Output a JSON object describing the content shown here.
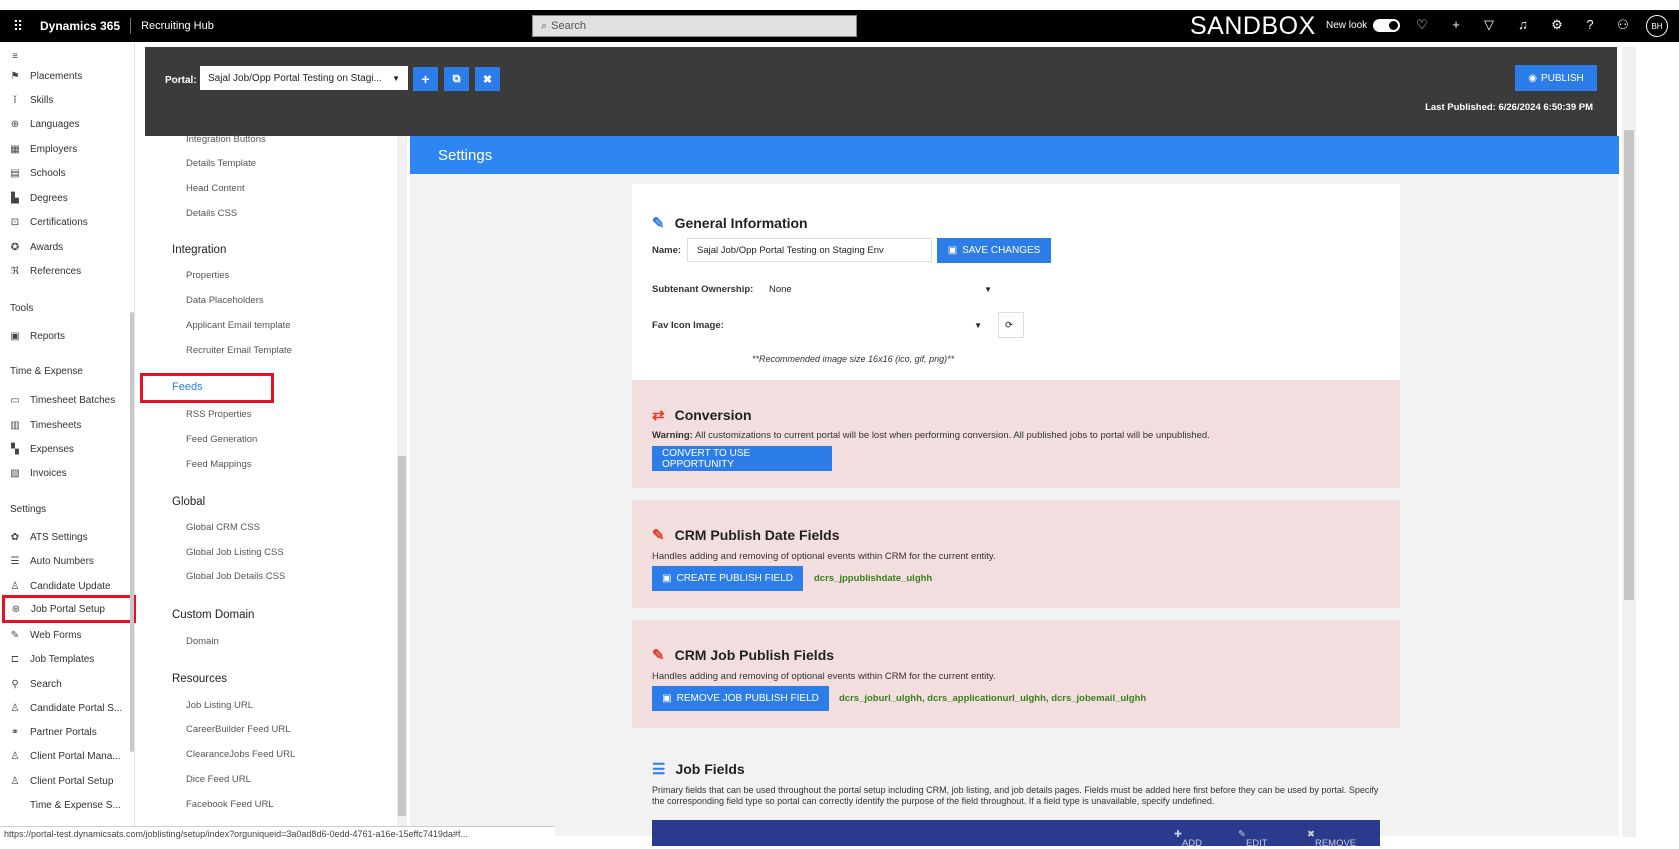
{
  "topbar": {
    "app_name": "Dynamics 365",
    "hub": "Recruiting Hub",
    "search_placeholder": "Search",
    "env_label": "SANDBOX",
    "new_look": "New look",
    "avatar": "BH"
  },
  "nav": {
    "items_top": [
      "Placements",
      "Skills",
      "Languages",
      "Employers",
      "Schools",
      "Degrees",
      "Certifications",
      "Awards",
      "References"
    ],
    "tools_head": "Tools",
    "reports": "Reports",
    "time_head": "Time & Expense",
    "time_items": [
      "Timesheet Batches",
      "Timesheets",
      "Expenses",
      "Invoices"
    ],
    "settings_head": "Settings",
    "settings_items": [
      "ATS Settings",
      "Auto Numbers",
      "Candidate Update",
      "Job Portal Setup",
      "Web Forms",
      "Job Templates",
      "Search",
      "Candidate Portal S...",
      "Partner Portals",
      "Client Portal Mana...",
      "Client Portal Setup",
      "Time & Expense S..."
    ]
  },
  "portal": {
    "label": "Portal:",
    "selected": "Sajal Job/Opp Portal Testing on Stagi...",
    "publish": "PUBLISH",
    "last_published": "Last Published: 6/26/2024 6:50:39 PM"
  },
  "panel": {
    "top_links": [
      "Integration Buttons",
      "Details Template",
      "Head Content",
      "Details CSS"
    ],
    "integration_head": "Integration",
    "integration_links": [
      "Properties",
      "Data Placeholders",
      "Applicant Email template",
      "Recruiter Email Template"
    ],
    "feeds_head": "Feeds",
    "feeds_links": [
      "RSS Properties",
      "Feed Generation",
      "Feed Mappings"
    ],
    "global_head": "Global",
    "global_links": [
      "Global CRM CSS",
      "Global Job Listing CSS",
      "Global Job Details CSS"
    ],
    "domain_head": "Custom Domain",
    "domain_links": [
      "Domain"
    ],
    "resources_head": "Resources",
    "resources_links": [
      "Job Listing URL",
      "CareerBuilder Feed URL",
      "ClearanceJobs Feed URL",
      "Dice Feed URL",
      "Facebook Feed URL"
    ]
  },
  "main": {
    "header": "Settings",
    "general": {
      "title": "General Information",
      "name_label": "Name:",
      "name_value": "Sajal Job/Opp Portal Testing on Staging Env",
      "save": "SAVE CHANGES",
      "subtenant_label": "Subtenant Ownership:",
      "subtenant_value": "None",
      "favicon_label": "Fav Icon Image:",
      "favicon_note": "**Recommended image size 16x16 (ico, gif, png)**"
    },
    "conversion": {
      "title": "Conversion",
      "warning_label": "Warning:",
      "warning_text": "All customizations to current portal will be lost when performing conversion. All published jobs to portal will be unpublished.",
      "button": "CONVERT TO USE OPPORTUNITY"
    },
    "publish_date": {
      "title": "CRM Publish Date Fields",
      "desc": "Handles adding and removing of optional events within CRM for the current entity.",
      "button": "CREATE PUBLISH FIELD",
      "field": "dcrs_jppublishdate_ulghh"
    },
    "job_publish": {
      "title": "CRM Job Publish Fields",
      "desc": "Handles adding and removing of optional events within CRM for the current entity.",
      "button": "REMOVE JOB PUBLISH FIELD",
      "fields": "dcrs_joburl_ulghh, dcrs_applicationurl_ulghh, dcrs_jobemail_ulghh"
    },
    "job_fields": {
      "title": "Job Fields",
      "desc": "Primary fields that can be used throughout the portal setup including CRM, job listing, and job details pages. Fields must be added here first before they can be used by portal. Specify the corresponding field type so portal can correctly identify the purpose of the field throughout. If a field type is unavailable, specify undefined.",
      "add": "ADD",
      "edit": "EDIT",
      "remove": "REMOVE"
    }
  },
  "status_url": "https://portal-test.dynamicsats.com/joblisting/setup/index?orguniqueid=3a0ad8d6-0edd-4761-a16e-15effc7419da#f..."
}
